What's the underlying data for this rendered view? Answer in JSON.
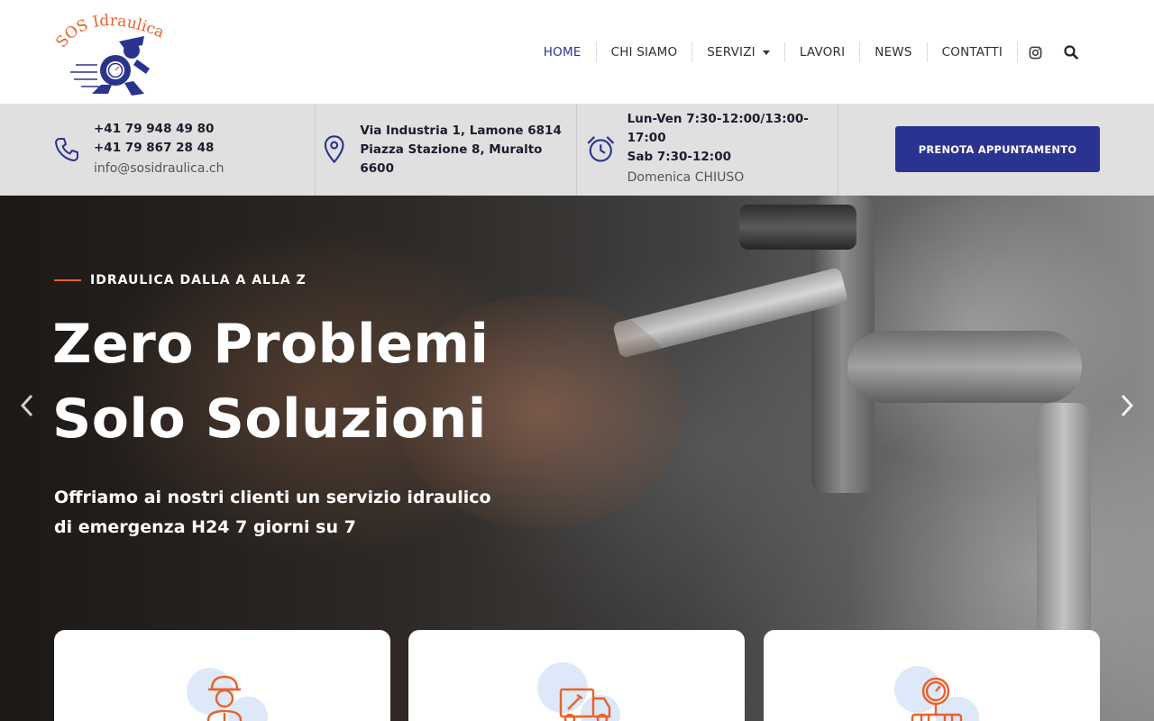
{
  "brand": {
    "logo_text": "SOS Idraulica",
    "accent_color": "#e8622a",
    "primary_color": "#2b3390"
  },
  "nav": {
    "items": [
      {
        "label": "HOME",
        "active": true
      },
      {
        "label": "CHI SIAMO"
      },
      {
        "label": "SERVIZI",
        "has_dropdown": true
      },
      {
        "label": "LAVORI"
      },
      {
        "label": "NEWS"
      },
      {
        "label": "CONTATTI"
      }
    ],
    "icons": [
      "instagram-icon",
      "search-icon"
    ]
  },
  "infobar": {
    "phone": {
      "icon": "phone-icon",
      "line1": "+41 79 948 49 80",
      "line2": "+41 79 867 28 48",
      "email": "info@sosidraulica.ch"
    },
    "address": {
      "icon": "map-pin-icon",
      "line1": "Via Industria 1, Lamone 6814",
      "line2": "Piazza Stazione 8, Muralto 6600"
    },
    "hours": {
      "icon": "alarm-clock-icon",
      "line1": "Lun-Ven 7:30-12:00/13:00-17:00",
      "line2": "Sab 7:30-12:00",
      "line3": "Domenica CHIUSO"
    },
    "cta_label": "PRENOTA APPUNTAMENTO"
  },
  "hero": {
    "eyebrow": "IDRAULICA DALLA A ALLA Z",
    "headline_line1": "Zero Problemi",
    "headline_line2": "Solo Soluzioni",
    "sub_line1": "Offriamo ai nostri clienti un servizio idraulico",
    "sub_line2": "di emergenza H24 7 giorni su 7",
    "prev_icon": "chevron-left-icon",
    "next_icon": "chevron-right-icon"
  },
  "cards": [
    {
      "icon": "plumber-worker-icon"
    },
    {
      "icon": "service-truck-icon"
    },
    {
      "icon": "pressure-gauge-pipes-icon"
    }
  ]
}
